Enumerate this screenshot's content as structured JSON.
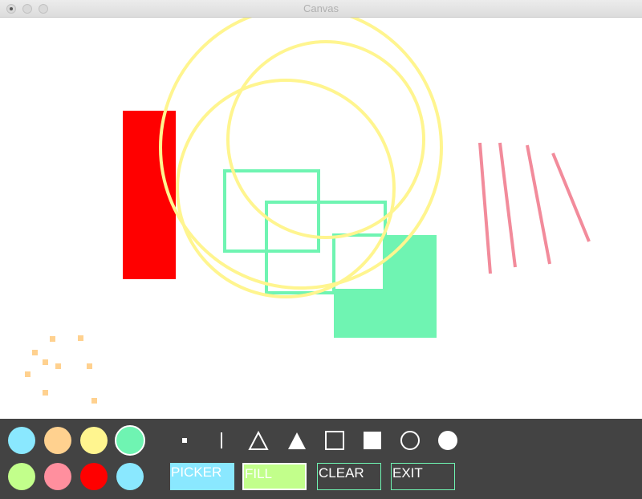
{
  "window": {
    "title": "Canvas"
  },
  "palette": {
    "colors": [
      "#8ae8ff",
      "#ffd18f",
      "#fff58f",
      "#6ff4b2",
      "#c2ff8b",
      "#ff8f9e",
      "#ff0000",
      "#8ae8ff"
    ],
    "selected_index": 3
  },
  "tools": [
    "point-tool",
    "line-tool",
    "triangle-outline-tool",
    "triangle-filled-tool",
    "square-outline-tool",
    "square-filled-tool",
    "circle-outline-tool",
    "circle-filled-tool"
  ],
  "buttons": {
    "picker": {
      "label": "PICKER",
      "color": "#8ae8ff"
    },
    "fill": {
      "label": "FILL",
      "color": "#c2ff8b"
    },
    "clear": {
      "label": "CLEAR",
      "color": "#6ff4b2"
    },
    "exit": {
      "label": "EXIT",
      "color": "#6ff4b2"
    }
  },
  "drawing_colors": {
    "red": "#ff0000",
    "yellow": "#fff58f",
    "green": "#6ff4b2",
    "pink": "#f28b9b",
    "orange": "#ffd18f"
  }
}
